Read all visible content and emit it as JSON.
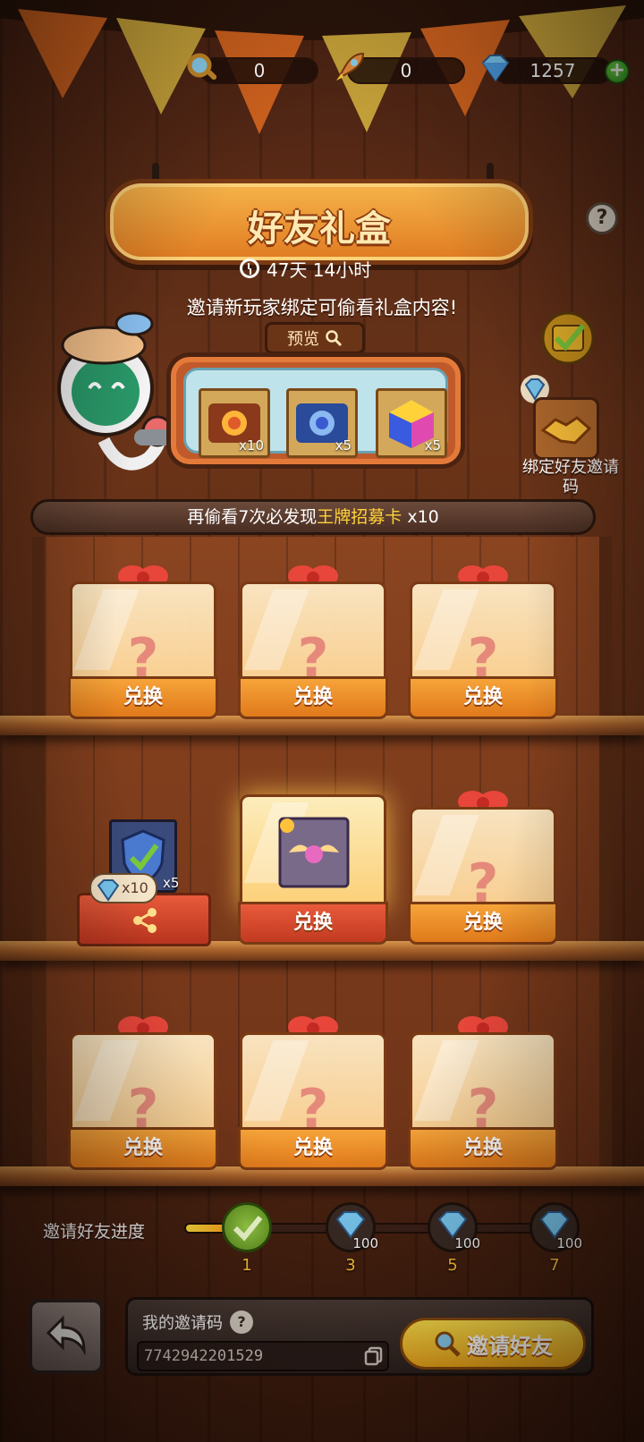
{
  "resources": {
    "magnifier_count": "0",
    "rocket_count": "0",
    "gem_count": "1257",
    "plus_label": "+"
  },
  "header": {
    "title": "好友礼盒",
    "help_label": "?",
    "timer": "47天  14小时",
    "invite_hint": "邀请新玩家绑定可偷看礼盒内容!"
  },
  "preview": {
    "label": "预览",
    "items": [
      {
        "icon": "golden-emblem-card-icon",
        "count": "x10"
      },
      {
        "icon": "blue-emblem-card-icon",
        "count": "x5"
      },
      {
        "icon": "rainbow-cube-icon",
        "count": "x5"
      }
    ]
  },
  "bind_friend": {
    "label": "绑定好友邀请码"
  },
  "banner": {
    "prefix": "再偷看7次必发现",
    "highlight": "王牌招募卡",
    "suffix": " x10"
  },
  "gifts": {
    "exchange_label": "兑换",
    "question": "?",
    "opened_bubble": "x10",
    "opened_card_count": "x5"
  },
  "progress": {
    "label": "邀请好友进度",
    "fill_fraction": 0.12,
    "nodes": [
      {
        "num": "1",
        "reward": "",
        "done": true
      },
      {
        "num": "3",
        "reward": "100",
        "done": false
      },
      {
        "num": "5",
        "reward": "100",
        "done": false
      },
      {
        "num": "7",
        "reward": "100",
        "done": false
      }
    ]
  },
  "footer": {
    "code_title": "我的邀请码",
    "code_help": "?",
    "code_value": "7742942201529",
    "invite_button": "邀请好友"
  },
  "colors": {
    "accent_orange": "#f6a43a",
    "accent_yellow": "#ffd23a",
    "wood_dark": "#4a2213"
  }
}
